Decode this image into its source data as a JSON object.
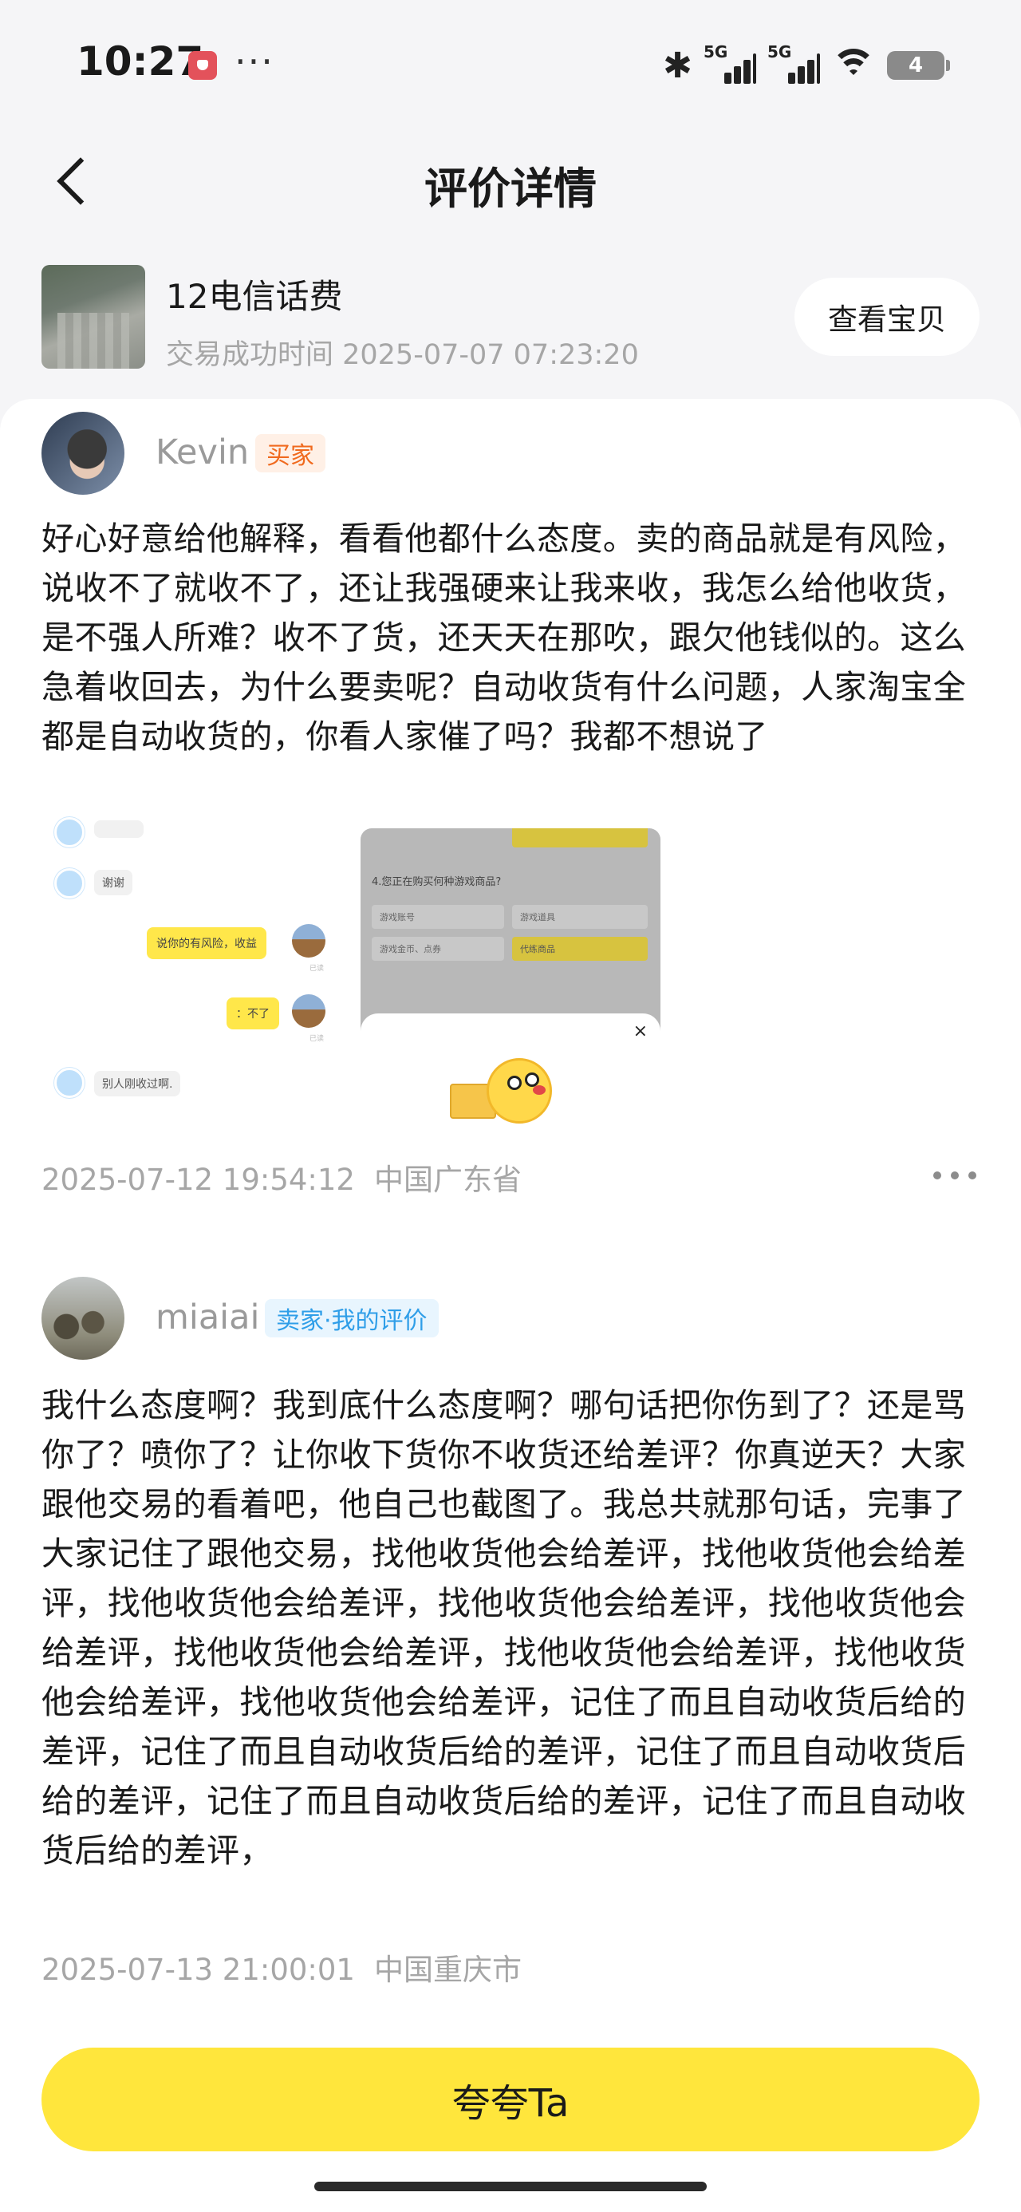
{
  "status_bar": {
    "time": "10:27",
    "dots": "···",
    "network_tag_1": "5G",
    "network_tag_2": "5G",
    "battery": "4"
  },
  "nav": {
    "title": "评价详情"
  },
  "product": {
    "title": "12电信话费",
    "time": "交易成功时间 2025-07-07 07:23:20",
    "view_button": "查看宝贝"
  },
  "reviews": [
    {
      "username": "Kevin",
      "badge": "买家",
      "text": "好心好意给他解释，看看他都什么态度。卖的商品就是有风险，说收不了就收不了，还让我强硬来让我来收，我怎么给他收货，是不强人所难？收不了货，还天天在那吹，跟欠他钱似的。这么急着收回去，为什么要卖呢？自动收货有什么问题，人家淘宝全都是自动收货的，你看人家催了吗？我都不想说了",
      "date": "2025-07-12 19:54:12",
      "location": "中国广东省",
      "image": {
        "chat_thanks": "谢谢",
        "chat_risk": "说你的有风险，收益",
        "chat_cannot": "：不了",
        "chat_others": "别人刚收过啊.",
        "form_question": "4.您正在购买何种游戏商品?",
        "form_options": [
          "游戏账号",
          "游戏道具",
          "游戏金币、点券",
          "代练商品"
        ],
        "form_close": "×"
      }
    },
    {
      "username": "miaiai",
      "badge": "卖家·我的评价",
      "text": "我什么态度啊？我到底什么态度啊？哪句话把你伤到了？还是骂你了？喷你了？让你收下货你不收货还给差评？你真逆天？大家跟他交易的看着吧，他自己也截图了。我总共就那句话，完事了大家记住了跟他交易，找他收货他会给差评，找他收货他会给差评，找他收货他会给差评，找他收货他会给差评，找他收货他会给差评，找他收货他会给差评，找他收货他会给差评，找他收货他会给差评，找他收货他会给差评，记住了而且自动收货后给的差评，记住了而且自动收货后给的差评，记住了而且自动收货后给的差评，记住了而且自动收货后给的差评，记住了而且自动收货后给的差评，",
      "date": "2025-07-13 21:00:01",
      "location": "中国重庆市"
    }
  ],
  "bottom": {
    "praise_button": "夸夸Ta"
  }
}
